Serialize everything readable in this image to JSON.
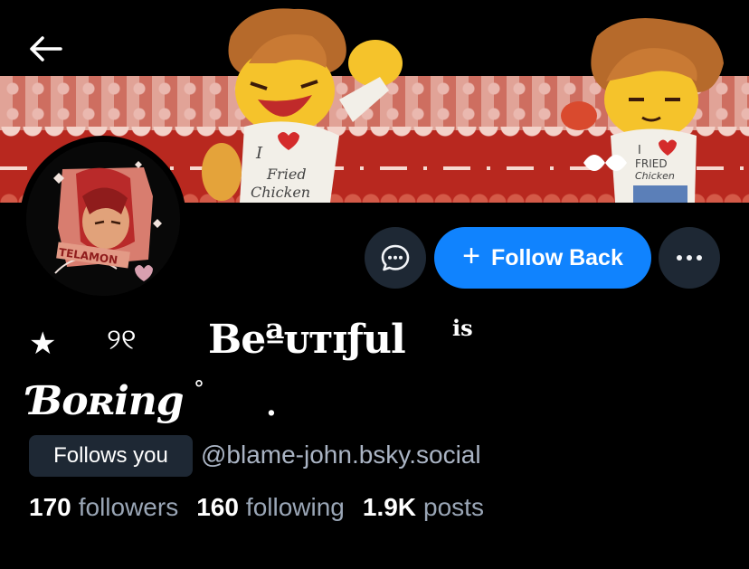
{
  "header": {
    "back_icon": "arrow-left-icon",
    "banner": {
      "left_shirt_text": "I ♥ Fried Chicken",
      "right_shirt_text": "I ♥ FRIED Chicken"
    }
  },
  "avatar": {
    "label": "TELAMON"
  },
  "actions": {
    "chat_icon": "chat-bubble-icon",
    "follow_back_label": "Follow Back",
    "follow_back_icon": "plus-icon",
    "more_icon": "more-horizontal-icon"
  },
  "profile": {
    "display_name_parts": [
      "★",
      "୨୧",
      "Beªᴜᴛɪƒul",
      "is",
      "Ɓᴏʀing",
      "°",
      "."
    ],
    "follows_you_label": "Follows you",
    "handle": "@blame-john.bsky.social"
  },
  "stats": {
    "followers_count": "170",
    "followers_label": "followers",
    "following_count": "160",
    "following_label": "following",
    "posts_count": "1.9K",
    "posts_label": "posts"
  },
  "colors": {
    "background": "#000000",
    "accent_blue": "#1083fe",
    "button_dark": "#1e2834",
    "muted_text": "#9aa6b6",
    "banner_red": "#b8281f"
  }
}
